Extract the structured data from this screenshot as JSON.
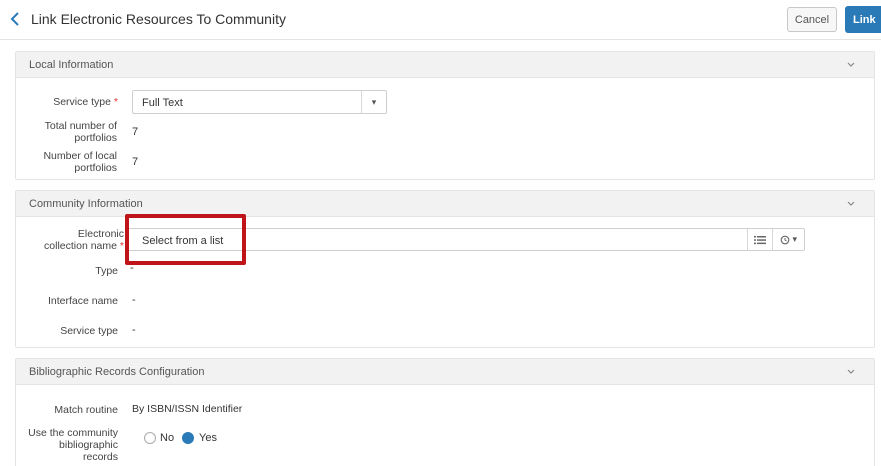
{
  "header": {
    "title": "Link Electronic Resources To Community",
    "cancel_label": "Cancel",
    "link_label": "Link"
  },
  "local_info": {
    "title": "Local Information",
    "service_type_label": "Service type",
    "service_type_value": "Full Text",
    "total_portfolios_label_1": "Total number of",
    "total_portfolios_label_2": "portfolios",
    "total_portfolios_value": "7",
    "local_portfolios_label_1": "Number of local",
    "local_portfolios_label_2": "portfolios",
    "local_portfolios_value": "7"
  },
  "community_info": {
    "title": "Community Information",
    "collection_label_1": "Electronic",
    "collection_label_2": "collection name",
    "collection_placeholder": "Select from a list",
    "type_label": "Type",
    "type_value": "-",
    "interface_label": "Interface name",
    "interface_value": "-",
    "service_type_label": "Service type",
    "service_type_value": "-"
  },
  "biblio_config": {
    "title": "Bibliographic Records Configuration",
    "match_label": "Match routine",
    "match_value": "By ISBN/ISSN Identifier",
    "use_label_1": "Use the community",
    "use_label_2": "bibliographic",
    "use_label_3": "records",
    "option_no": "No",
    "option_yes": "Yes",
    "selected": "Yes"
  },
  "required_marker": "*",
  "colors": {
    "accent": "#2b7ab8",
    "highlight": "#c0141b",
    "required": "#d33333"
  }
}
